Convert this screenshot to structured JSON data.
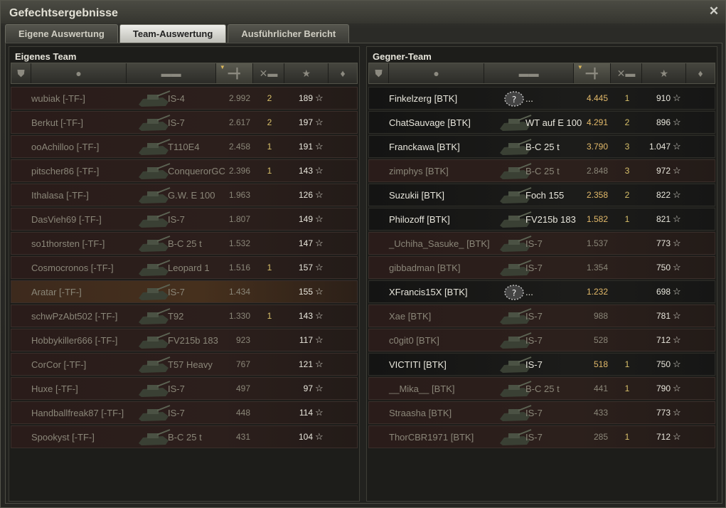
{
  "window": {
    "title": "Gefechtsergebnisse"
  },
  "tabs": [
    {
      "label": "Eigene Auswertung"
    },
    {
      "label": "Team-Auswertung"
    },
    {
      "label": "Ausführlicher Bericht"
    }
  ],
  "own_team": {
    "title": "Eigenes Team",
    "rows": [
      {
        "player": "wubiak [-TF-]",
        "tank": "IS-4",
        "xp": "2.992",
        "kills": "2",
        "score": "189"
      },
      {
        "player": "Berkut [-TF-]",
        "tank": "IS-7",
        "xp": "2.617",
        "kills": "2",
        "score": "197"
      },
      {
        "player": "ooAchilloo [-TF-]",
        "tank": "T110E4",
        "xp": "2.458",
        "kills": "1",
        "score": "191"
      },
      {
        "player": "pitscher86 [-TF-]",
        "tank": "ConquerorGC",
        "xp": "2.396",
        "kills": "1",
        "score": "143"
      },
      {
        "player": "Ithalasa [-TF-]",
        "tank": "G.W. E 100",
        "xp": "1.963",
        "kills": "",
        "score": "126"
      },
      {
        "player": "DasVieh69 [-TF-]",
        "tank": "IS-7",
        "xp": "1.807",
        "kills": "",
        "score": "149"
      },
      {
        "player": "so1thorsten [-TF-]",
        "tank": "B-C 25 t",
        "xp": "1.532",
        "kills": "",
        "score": "147"
      },
      {
        "player": "Cosmocronos [-TF-]",
        "tank": "Leopard 1",
        "xp": "1.516",
        "kills": "1",
        "score": "157"
      },
      {
        "player": "Aratar [-TF-]",
        "tank": "IS-7",
        "xp": "1.434",
        "kills": "",
        "score": "155"
      },
      {
        "player": "schwPzAbt502 [-TF-]",
        "tank": "T92",
        "xp": "1.330",
        "kills": "1",
        "score": "143"
      },
      {
        "player": "Hobbykiller666 [-TF-]",
        "tank": "FV215b 183",
        "xp": "923",
        "kills": "",
        "score": "117"
      },
      {
        "player": "CorCor [-TF-]",
        "tank": "T57 Heavy",
        "xp": "767",
        "kills": "",
        "score": "121"
      },
      {
        "player": "Huxe [-TF-]",
        "tank": "IS-7",
        "xp": "497",
        "kills": "",
        "score": "97"
      },
      {
        "player": "Handballfreak87 [-TF-]",
        "tank": "IS-7",
        "xp": "448",
        "kills": "",
        "score": "114"
      },
      {
        "player": "Spookyst [-TF-]",
        "tank": "B-C 25 t",
        "xp": "431",
        "kills": "",
        "score": "104"
      }
    ]
  },
  "enemy_team": {
    "title": "Gegner-Team",
    "rows": [
      {
        "player": "Finkelzerg [BTK]",
        "tank": "...",
        "xp": "4.445",
        "kills": "1",
        "score": "910",
        "alive": true
      },
      {
        "player": "ChatSauvage [BTK]",
        "tank": "WT auf E 100",
        "xp": "4.291",
        "kills": "2",
        "score": "896",
        "alive": true
      },
      {
        "player": "Franckawa [BTK]",
        "tank": "B-C 25 t",
        "xp": "3.790",
        "kills": "3",
        "score": "1.047",
        "alive": true
      },
      {
        "player": "zimphys [BTK]",
        "tank": "B-C 25 t",
        "xp": "2.848",
        "kills": "3",
        "score": "972",
        "alive": false
      },
      {
        "player": "Suzukii [BTK]",
        "tank": "Foch 155",
        "xp": "2.358",
        "kills": "2",
        "score": "822",
        "alive": true
      },
      {
        "player": "Philozoff [BTK]",
        "tank": "FV215b 183",
        "xp": "1.582",
        "kills": "1",
        "score": "821",
        "alive": true
      },
      {
        "player": "_Uchiha_Sasuke_ [BTK]",
        "tank": "IS-7",
        "xp": "1.537",
        "kills": "",
        "score": "773",
        "alive": false
      },
      {
        "player": "gibbadman [BTK]",
        "tank": "IS-7",
        "xp": "1.354",
        "kills": "",
        "score": "750",
        "alive": false
      },
      {
        "player": "XFrancis15X [BTK]",
        "tank": "...",
        "xp": "1.232",
        "kills": "",
        "score": "698",
        "alive": true
      },
      {
        "player": "Xae [BTK]",
        "tank": "IS-7",
        "xp": "988",
        "kills": "",
        "score": "781",
        "alive": false
      },
      {
        "player": "c0git0 [BTK]",
        "tank": "IS-7",
        "xp": "528",
        "kills": "",
        "score": "712",
        "alive": false
      },
      {
        "player": "VICTITI [BTK]",
        "tank": "IS-7",
        "xp": "518",
        "kills": "1",
        "score": "750",
        "alive": true
      },
      {
        "player": "__Mika__ [BTK]",
        "tank": "B-C 25 t",
        "xp": "441",
        "kills": "1",
        "score": "790",
        "alive": false
      },
      {
        "player": "Straasha [BTK]",
        "tank": "IS-7",
        "xp": "433",
        "kills": "",
        "score": "773",
        "alive": false
      },
      {
        "player": "ThorCBR1971 [BTK]",
        "tank": "IS-7",
        "xp": "285",
        "kills": "1",
        "score": "712",
        "alive": false
      }
    ]
  },
  "icons": {
    "close": "close-icon",
    "squad": "squad-shield-icon",
    "player": "player-silhouette-icon",
    "tank": "tank-icon",
    "damage": "damage-icon",
    "kills": "destroyed-tank-icon",
    "star": "star-icon",
    "medal": "medal-icon"
  },
  "colors": {
    "alive_xp": "#e2b96a",
    "kills": "#d8c06a",
    "active_tab": "#eeeeea"
  }
}
